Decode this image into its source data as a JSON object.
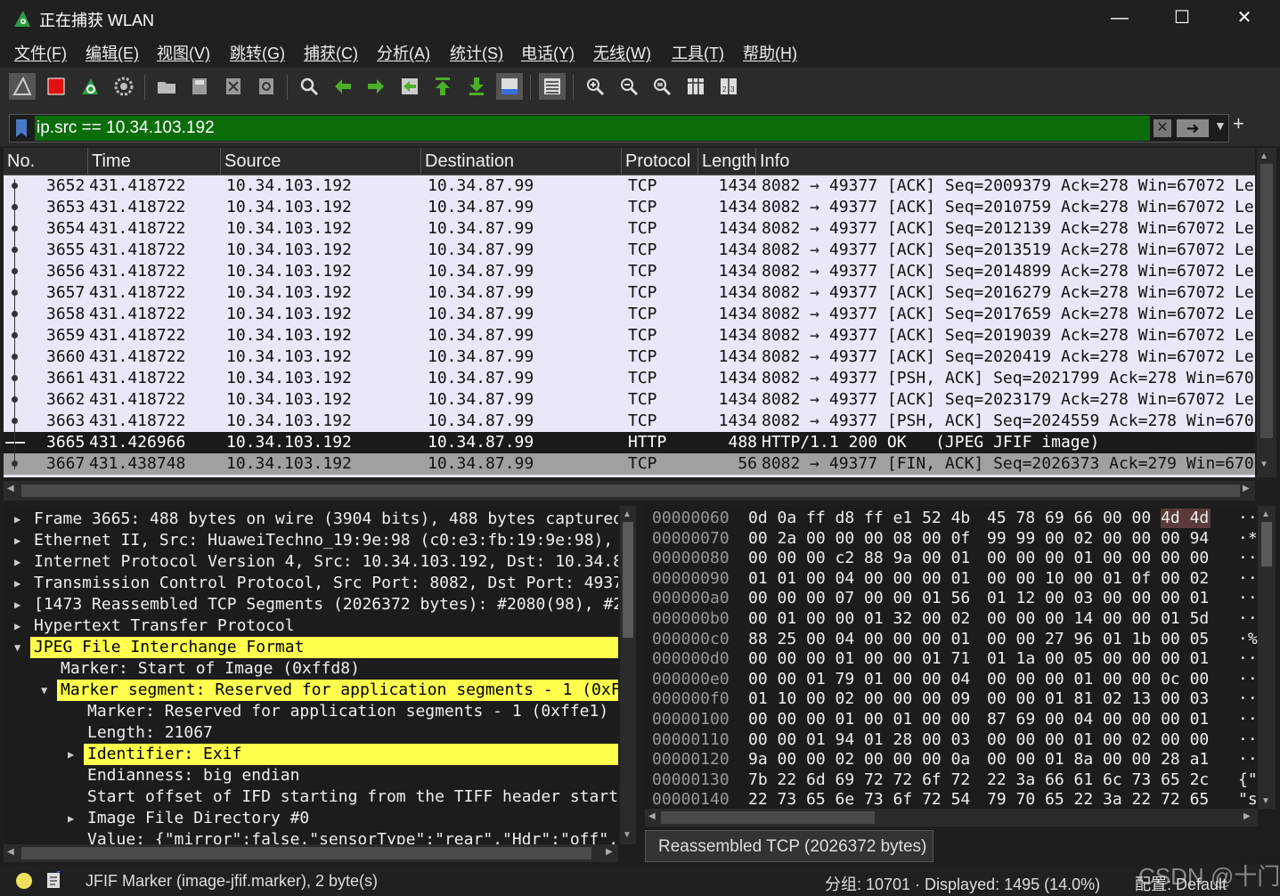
{
  "window": {
    "title": "正在捕获 WLAN"
  },
  "menu": [
    "文件(F)",
    "编辑(E)",
    "视图(V)",
    "跳转(G)",
    "捕获(C)",
    "分析(A)",
    "统计(S)",
    "电话(Y)",
    "无线(W)",
    "工具(T)",
    "帮助(H)"
  ],
  "filter": {
    "value": "ip.src == 10.34.103.192"
  },
  "packet_list": {
    "columns": [
      "No.",
      "Time",
      "Source",
      "Destination",
      "Protocol",
      "Length",
      "Info"
    ],
    "rows": [
      {
        "no": "3652",
        "time": "431.418722",
        "src": "10.34.103.192",
        "dst": "10.34.87.99",
        "proto": "TCP",
        "len": "1434",
        "info": "8082 → 49377 [ACK] Seq=2009379 Ack=278 Win=67072 Len"
      },
      {
        "no": "3653",
        "time": "431.418722",
        "src": "10.34.103.192",
        "dst": "10.34.87.99",
        "proto": "TCP",
        "len": "1434",
        "info": "8082 → 49377 [ACK] Seq=2010759 Ack=278 Win=67072 Len"
      },
      {
        "no": "3654",
        "time": "431.418722",
        "src": "10.34.103.192",
        "dst": "10.34.87.99",
        "proto": "TCP",
        "len": "1434",
        "info": "8082 → 49377 [ACK] Seq=2012139 Ack=278 Win=67072 Len"
      },
      {
        "no": "3655",
        "time": "431.418722",
        "src": "10.34.103.192",
        "dst": "10.34.87.99",
        "proto": "TCP",
        "len": "1434",
        "info": "8082 → 49377 [ACK] Seq=2013519 Ack=278 Win=67072 Len"
      },
      {
        "no": "3656",
        "time": "431.418722",
        "src": "10.34.103.192",
        "dst": "10.34.87.99",
        "proto": "TCP",
        "len": "1434",
        "info": "8082 → 49377 [ACK] Seq=2014899 Ack=278 Win=67072 Len"
      },
      {
        "no": "3657",
        "time": "431.418722",
        "src": "10.34.103.192",
        "dst": "10.34.87.99",
        "proto": "TCP",
        "len": "1434",
        "info": "8082 → 49377 [ACK] Seq=2016279 Ack=278 Win=67072 Len"
      },
      {
        "no": "3658",
        "time": "431.418722",
        "src": "10.34.103.192",
        "dst": "10.34.87.99",
        "proto": "TCP",
        "len": "1434",
        "info": "8082 → 49377 [ACK] Seq=2017659 Ack=278 Win=67072 Len"
      },
      {
        "no": "3659",
        "time": "431.418722",
        "src": "10.34.103.192",
        "dst": "10.34.87.99",
        "proto": "TCP",
        "len": "1434",
        "info": "8082 → 49377 [ACK] Seq=2019039 Ack=278 Win=67072 Len"
      },
      {
        "no": "3660",
        "time": "431.418722",
        "src": "10.34.103.192",
        "dst": "10.34.87.99",
        "proto": "TCP",
        "len": "1434",
        "info": "8082 → 49377 [ACK] Seq=2020419 Ack=278 Win=67072 Len"
      },
      {
        "no": "3661",
        "time": "431.418722",
        "src": "10.34.103.192",
        "dst": "10.34.87.99",
        "proto": "TCP",
        "len": "1434",
        "info": "8082 → 49377 [PSH, ACK] Seq=2021799 Ack=278 Win=6707"
      },
      {
        "no": "3662",
        "time": "431.418722",
        "src": "10.34.103.192",
        "dst": "10.34.87.99",
        "proto": "TCP",
        "len": "1434",
        "info": "8082 → 49377 [ACK] Seq=2023179 Ack=278 Win=67072 Len"
      },
      {
        "no": "3663",
        "time": "431.418722",
        "src": "10.34.103.192",
        "dst": "10.34.87.99",
        "proto": "TCP",
        "len": "1434",
        "info": "8082 → 49377 [PSH, ACK] Seq=2024559 Ack=278 Win=6707"
      },
      {
        "no": "3665",
        "time": "431.426966",
        "src": "10.34.103.192",
        "dst": "10.34.87.99",
        "proto": "HTTP",
        "len": "488",
        "info": "HTTP/1.1 200 OK   (JPEG JFIF image)"
      },
      {
        "no": "3667",
        "time": "431.438748",
        "src": "10.34.103.192",
        "dst": "10.34.87.99",
        "proto": "TCP",
        "len": "56",
        "info": "8082 → 49377 [FIN, ACK] Seq=2026373 Ack=279 Win=6707"
      }
    ]
  },
  "details": [
    {
      "text": "Frame 3665: 488 bytes on wire (3904 bits), 488 bytes captured",
      "indent": 0,
      "arrow": "right",
      "hl": false
    },
    {
      "text": "Ethernet II, Src: HuaweiTechno_19:9e:98 (c0:e3:fb:19:9e:98),",
      "indent": 0,
      "arrow": "right",
      "hl": false
    },
    {
      "text": "Internet Protocol Version 4, Src: 10.34.103.192, Dst: 10.34.8",
      "indent": 0,
      "arrow": "right",
      "hl": false
    },
    {
      "text": "Transmission Control Protocol, Src Port: 8082, Dst Port: 4937",
      "indent": 0,
      "arrow": "right",
      "hl": false
    },
    {
      "text": "[1473 Reassembled TCP Segments (2026372 bytes): #2080(98), #2",
      "indent": 0,
      "arrow": "right",
      "hl": false
    },
    {
      "text": "Hypertext Transfer Protocol",
      "indent": 0,
      "arrow": "right",
      "hl": false
    },
    {
      "text": "JPEG File Interchange Format",
      "indent": 0,
      "arrow": "down",
      "hl": true
    },
    {
      "text": "Marker: Start of Image (0xffd8)",
      "indent": 1,
      "arrow": "",
      "hl": false
    },
    {
      "text": "Marker segment: Reserved for application segments - 1 (0xF",
      "indent": 1,
      "arrow": "down",
      "hl": true
    },
    {
      "text": "Marker: Reserved for application segments - 1 (0xffe1)",
      "indent": 2,
      "arrow": "",
      "hl": false
    },
    {
      "text": "Length: 21067",
      "indent": 2,
      "arrow": "",
      "hl": false
    },
    {
      "text": "Identifier: Exif",
      "indent": 2,
      "arrow": "right",
      "hl": true
    },
    {
      "text": "Endianness: big endian",
      "indent": 2,
      "arrow": "",
      "hl": false
    },
    {
      "text": "Start offset of IFD starting from the TIFF header start:",
      "indent": 2,
      "arrow": "",
      "hl": false
    },
    {
      "text": "Image File Directory #0",
      "indent": 2,
      "arrow": "right",
      "hl": false
    },
    {
      "text": "Value: {\"mirror\":false,\"sensorType\":\"rear\",\"Hdr\":\"off\",",
      "indent": 2,
      "arrow": "",
      "hl": false
    }
  ],
  "bytes": [
    {
      "off": "00000060",
      "hex1": "0d 0a ff d8 ff e1 52 4b",
      "hex2": "45 78 69 66 00 00 4d 4d",
      "ascii": "··"
    },
    {
      "off": "00000070",
      "hex1": "00 2a 00 00 00 08 00 0f",
      "hex2": "99 99 00 02 00 00 00 94",
      "ascii": "·*"
    },
    {
      "off": "00000080",
      "hex1": "00 00 00 c2 88 9a 00 01",
      "hex2": "00 00 00 01 00 00 00 00",
      "ascii": "··"
    },
    {
      "off": "00000090",
      "hex1": "01 01 00 04 00 00 00 01",
      "hex2": "00 00 10 00 01 0f 00 02",
      "ascii": "··"
    },
    {
      "off": "000000a0",
      "hex1": "00 00 00 07 00 00 01 56",
      "hex2": "01 12 00 03 00 00 00 01",
      "ascii": "··"
    },
    {
      "off": "000000b0",
      "hex1": "00 01 00 00 01 32 00 02",
      "hex2": "00 00 00 14 00 00 01 5d",
      "ascii": "··"
    },
    {
      "off": "000000c0",
      "hex1": "88 25 00 04 00 00 00 01",
      "hex2": "00 00 27 96 01 1b 00 05",
      "ascii": "·%"
    },
    {
      "off": "000000d0",
      "hex1": "00 00 00 01 00 00 01 71",
      "hex2": "01 1a 00 05 00 00 00 01",
      "ascii": "··"
    },
    {
      "off": "000000e0",
      "hex1": "00 00 01 79 01 00 00 04",
      "hex2": "00 00 00 01 00 00 0c 00",
      "ascii": "··"
    },
    {
      "off": "000000f0",
      "hex1": "01 10 00 02 00 00 00 09",
      "hex2": "00 00 01 81 02 13 00 03",
      "ascii": "··"
    },
    {
      "off": "00000100",
      "hex1": "00 00 00 01 00 01 00 00",
      "hex2": "87 69 00 04 00 00 00 01",
      "ascii": "··"
    },
    {
      "off": "00000110",
      "hex1": "00 00 01 94 01 28 00 03",
      "hex2": "00 00 00 01 00 02 00 00",
      "ascii": "··"
    },
    {
      "off": "00000120",
      "hex1": "9a 00 00 02 00 00 00 0a",
      "hex2": "00 00 01 8a 00 00 28 a1",
      "ascii": "··"
    },
    {
      "off": "00000130",
      "hex1": "7b 22 6d 69 72 72 6f 72",
      "hex2": "22 3a 66 61 6c 73 65 2c",
      "ascii": "{\""
    },
    {
      "off": "00000140",
      "hex1": "22 73 65 6e 73 6f 72 54",
      "hex2": "79 70 65 22 3a 22 72 65",
      "ascii": "\"s"
    }
  ],
  "bytes_tab": "Reassembled TCP (2026372 bytes)",
  "status": {
    "field": "JFIF Marker (image-jfif.marker), 2 byte(s)",
    "packets": "分组: 10701 · Displayed: 1495 (14.0%)",
    "profile": "配置: Default"
  },
  "watermark": "CSDN @十门",
  "colors": {
    "filter_valid": "#0a6d0a",
    "highlight": "#ffff4d",
    "row_bg": "#e8e8f8",
    "selected_row": "#1a1a1a"
  }
}
